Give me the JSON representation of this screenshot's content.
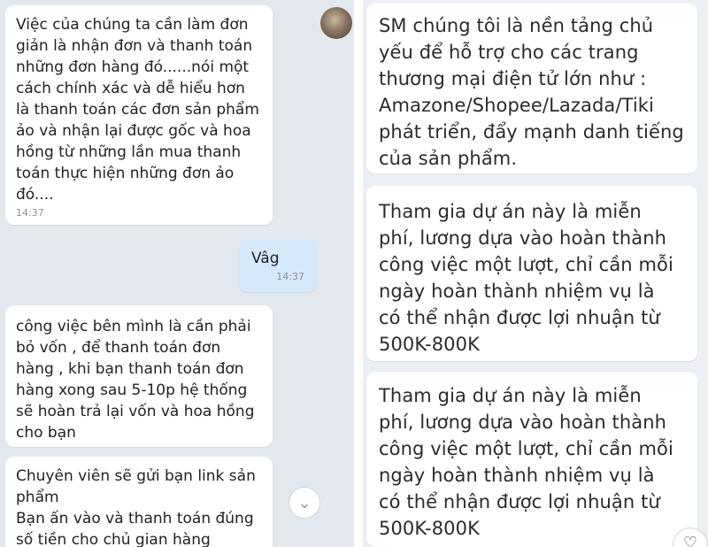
{
  "left_chat": {
    "messages": [
      {
        "text": "Việc của chúng ta cần làm đơn\ngiản là nhận đơn và thanh toán\nnhững đơn hàng đó......nói một\ncách chính xác và dễ hiểu hơn\nlà thanh toán các đơn sản phẩm\nảo và nhận lại được gốc và hoa\nhồng từ những lần mua thanh\ntoán thực hiện những đơn ảo\nđó....",
        "time": "14:37"
      },
      {
        "text": "Vâg",
        "time": "14:37"
      },
      {
        "text": "công việc bên mình là cần phải\nbỏ vốn , để thanh toán đơn\nhàng , khi bạn thanh toán đơn\nhàng xong sau 5-10p hệ thống\nsẽ hoàn trả lại vốn và hoa hồng\ncho bạn"
      },
      {
        "text": "Chuyên viên sẽ gửi bạn link sản\nphẩm\nBạn ấn vào và thanh toán đúng\nsố tiền cho chủ gian hàng"
      }
    ],
    "scroll_icon": "⌄"
  },
  "right_chat": {
    "messages": [
      {
        "text": "SM chúng tôi là nền tảng chủ\nyếu để hỗ trợ cho các trang\nthương mại điện tử lớn như :\nAmazone/Shopee/Lazada/Tiki\nphát triển, đẩy mạnh danh tiếng\ncủa sản phẩm."
      },
      {
        "text": "Tham gia dự án này là miễn\nphí,  lương dựa vào  hoàn thành\ncông việc một lượt, chỉ cần mỗi\nngày hoàn thành nhiệm vụ là\ncó thể nhận được lợi nhuận từ\n500K-800K"
      },
      {
        "text": "Tham gia dự án này là miễn\nphí,  lương dựa vào  hoàn thành\ncông việc một lượt, chỉ cần mỗi\nngày hoàn thành nhiệm vụ là\ncó thể nhận được lợi nhuận từ\n500K-800K"
      }
    ],
    "heart_icon": "♡"
  }
}
